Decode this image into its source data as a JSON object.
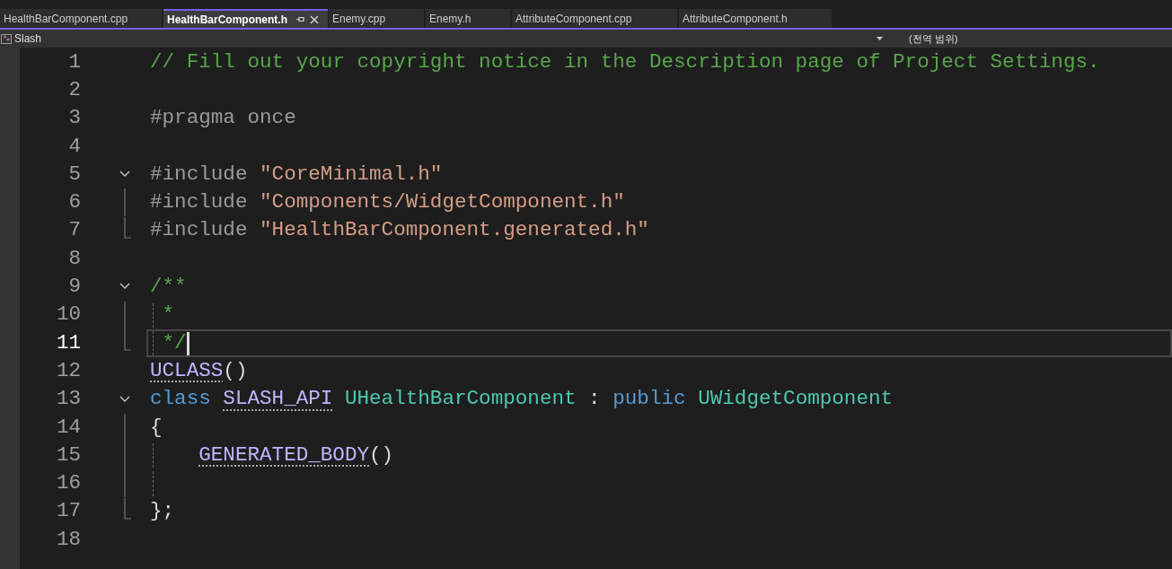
{
  "tabs": [
    {
      "label": "HealthBarComponent.cpp",
      "selected": false
    },
    {
      "label": "HealthBarComponent.h",
      "selected": true
    },
    {
      "label": "Enemy.cpp",
      "selected": false
    },
    {
      "label": "Enemy.h",
      "selected": false
    },
    {
      "label": "AttributeComponent.cpp",
      "selected": false
    },
    {
      "label": "AttributeComponent.h",
      "selected": false
    }
  ],
  "navigation_bar": {
    "project": "Slash",
    "scope": "(전역 범위)"
  },
  "lines": [
    {
      "number": "1",
      "tokens": [
        {
          "kind": "comment",
          "text": "// Fill out your copyright notice in the Description page of Project Settings."
        }
      ]
    },
    {
      "number": "2"
    },
    {
      "number": "3",
      "tokens": [
        {
          "kind": "preproc",
          "text": "#pragma once"
        }
      ]
    },
    {
      "number": "4"
    },
    {
      "number": "5",
      "expanded": true,
      "tokens": [
        {
          "kind": "preproc",
          "text": "#include "
        },
        {
          "kind": "string",
          "text": "\"CoreMinimal.h\""
        }
      ]
    },
    {
      "number": "6",
      "in_block": true,
      "tokens": [
        {
          "kind": "preproc",
          "text": "#include "
        },
        {
          "kind": "string",
          "text": "\"Components/WidgetComponent.h\""
        }
      ]
    },
    {
      "number": "7",
      "block_end": true,
      "tokens": [
        {
          "kind": "preproc",
          "text": "#include "
        },
        {
          "kind": "string",
          "text": "\"HealthBarComponent.generated.h\""
        }
      ]
    },
    {
      "number": "8"
    },
    {
      "number": "9",
      "expanded": true,
      "tokens": [
        {
          "kind": "comment",
          "text": "/**"
        }
      ]
    },
    {
      "number": "10",
      "in_block": true,
      "guide": true,
      "tokens": [
        {
          "kind": "comment",
          "text": " *"
        }
      ]
    },
    {
      "number": "11",
      "block_end": true,
      "guide": true,
      "current": true,
      "tokens": [
        {
          "kind": "comment",
          "text": " */"
        }
      ]
    },
    {
      "number": "12",
      "tokens": [
        {
          "kind": "macro",
          "text": "UCLASS",
          "hint": true
        },
        {
          "kind": "plain",
          "text": "()"
        }
      ]
    },
    {
      "number": "13",
      "expanded": true,
      "tokens": [
        {
          "kind": "keyword",
          "text": "class "
        },
        {
          "kind": "macro",
          "text": "SLASH_API",
          "hint": true
        },
        {
          "kind": "type",
          "text": " UHealthBarComponent"
        },
        {
          "kind": "plain",
          "text": " : "
        },
        {
          "kind": "keyword",
          "text": "public "
        },
        {
          "kind": "type",
          "text": "UWidgetComponent"
        }
      ]
    },
    {
      "number": "14",
      "in_block": true,
      "tokens": [
        {
          "kind": "plain",
          "text": "{"
        }
      ]
    },
    {
      "number": "15",
      "in_block": true,
      "guide": true,
      "indented": true,
      "tokens": [
        {
          "kind": "macro",
          "text": "GENERATED_BODY",
          "hint": true
        },
        {
          "kind": "plain",
          "text": "()"
        }
      ]
    },
    {
      "number": "16",
      "in_block": true,
      "guide": true
    },
    {
      "number": "17",
      "block_end": true,
      "tokens": [
        {
          "kind": "plain",
          "text": "};"
        }
      ]
    },
    {
      "number": "18"
    }
  ]
}
